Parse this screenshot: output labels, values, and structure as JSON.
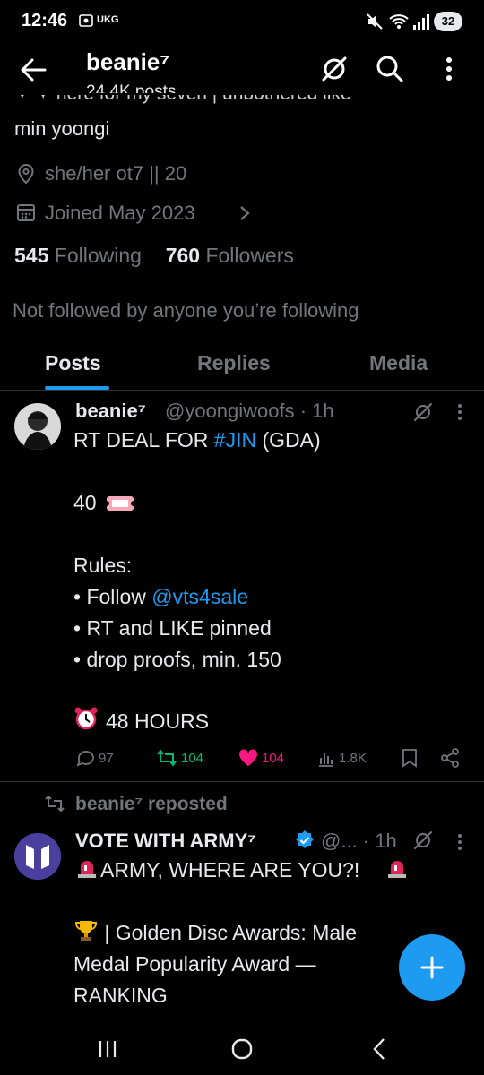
{
  "status_bar": {
    "time": "12:46",
    "carrier": "UKG",
    "battery": "32"
  },
  "header": {
    "title": "beanie⁷",
    "posts_count": "24.4K posts"
  },
  "profile": {
    "bio_fragment": "✦ ✦ here for my seven | unbothered like",
    "bio_line2": "min yoongi",
    "location": "she/her ot7 || 20",
    "joined": "Joined May 2023",
    "following_count": "545",
    "following_label": "Following",
    "followers_count": "760",
    "followers_label": "Followers",
    "not_followed": "Not followed by anyone you’re following"
  },
  "tabs": {
    "posts": "Posts",
    "replies": "Replies",
    "media": "Media"
  },
  "tweet1": {
    "name": "beanie⁷",
    "handle_time": "@yoongiwoofs · 1h",
    "line1_prefix": "RT DEAL FOR ",
    "hashtag": "#JIN",
    "line1_suffix": " (GDA)",
    "count_line": "40",
    "rules_title": "Rules:",
    "rule1_prefix": "• Follow ",
    "rule1_mention": "@vts4sale",
    "rule2": "• RT and LIKE pinned",
    "rule3": "• drop proofs, min. 150",
    "deadline": "48 HOURS",
    "replies": "97",
    "retweets": "104",
    "likes": "104",
    "views": "1.8K"
  },
  "tweet2": {
    "repost_label": "beanie⁷ reposted",
    "name": "VOTE WITH ARMY⁷",
    "handle_time": "@... · 1h",
    "line1": "ARMY, WHERE ARE YOU?!",
    "line2": " | Golden Disc Awards: Male",
    "line3": "Medal Popularity Award —",
    "line4": "RANKING"
  },
  "colors": {
    "accent": "#1d9bf0",
    "retweet": "#00ba7c",
    "like": "#f91880",
    "muted": "#71767b",
    "text": "#e7e9ea",
    "background": "#000000"
  }
}
